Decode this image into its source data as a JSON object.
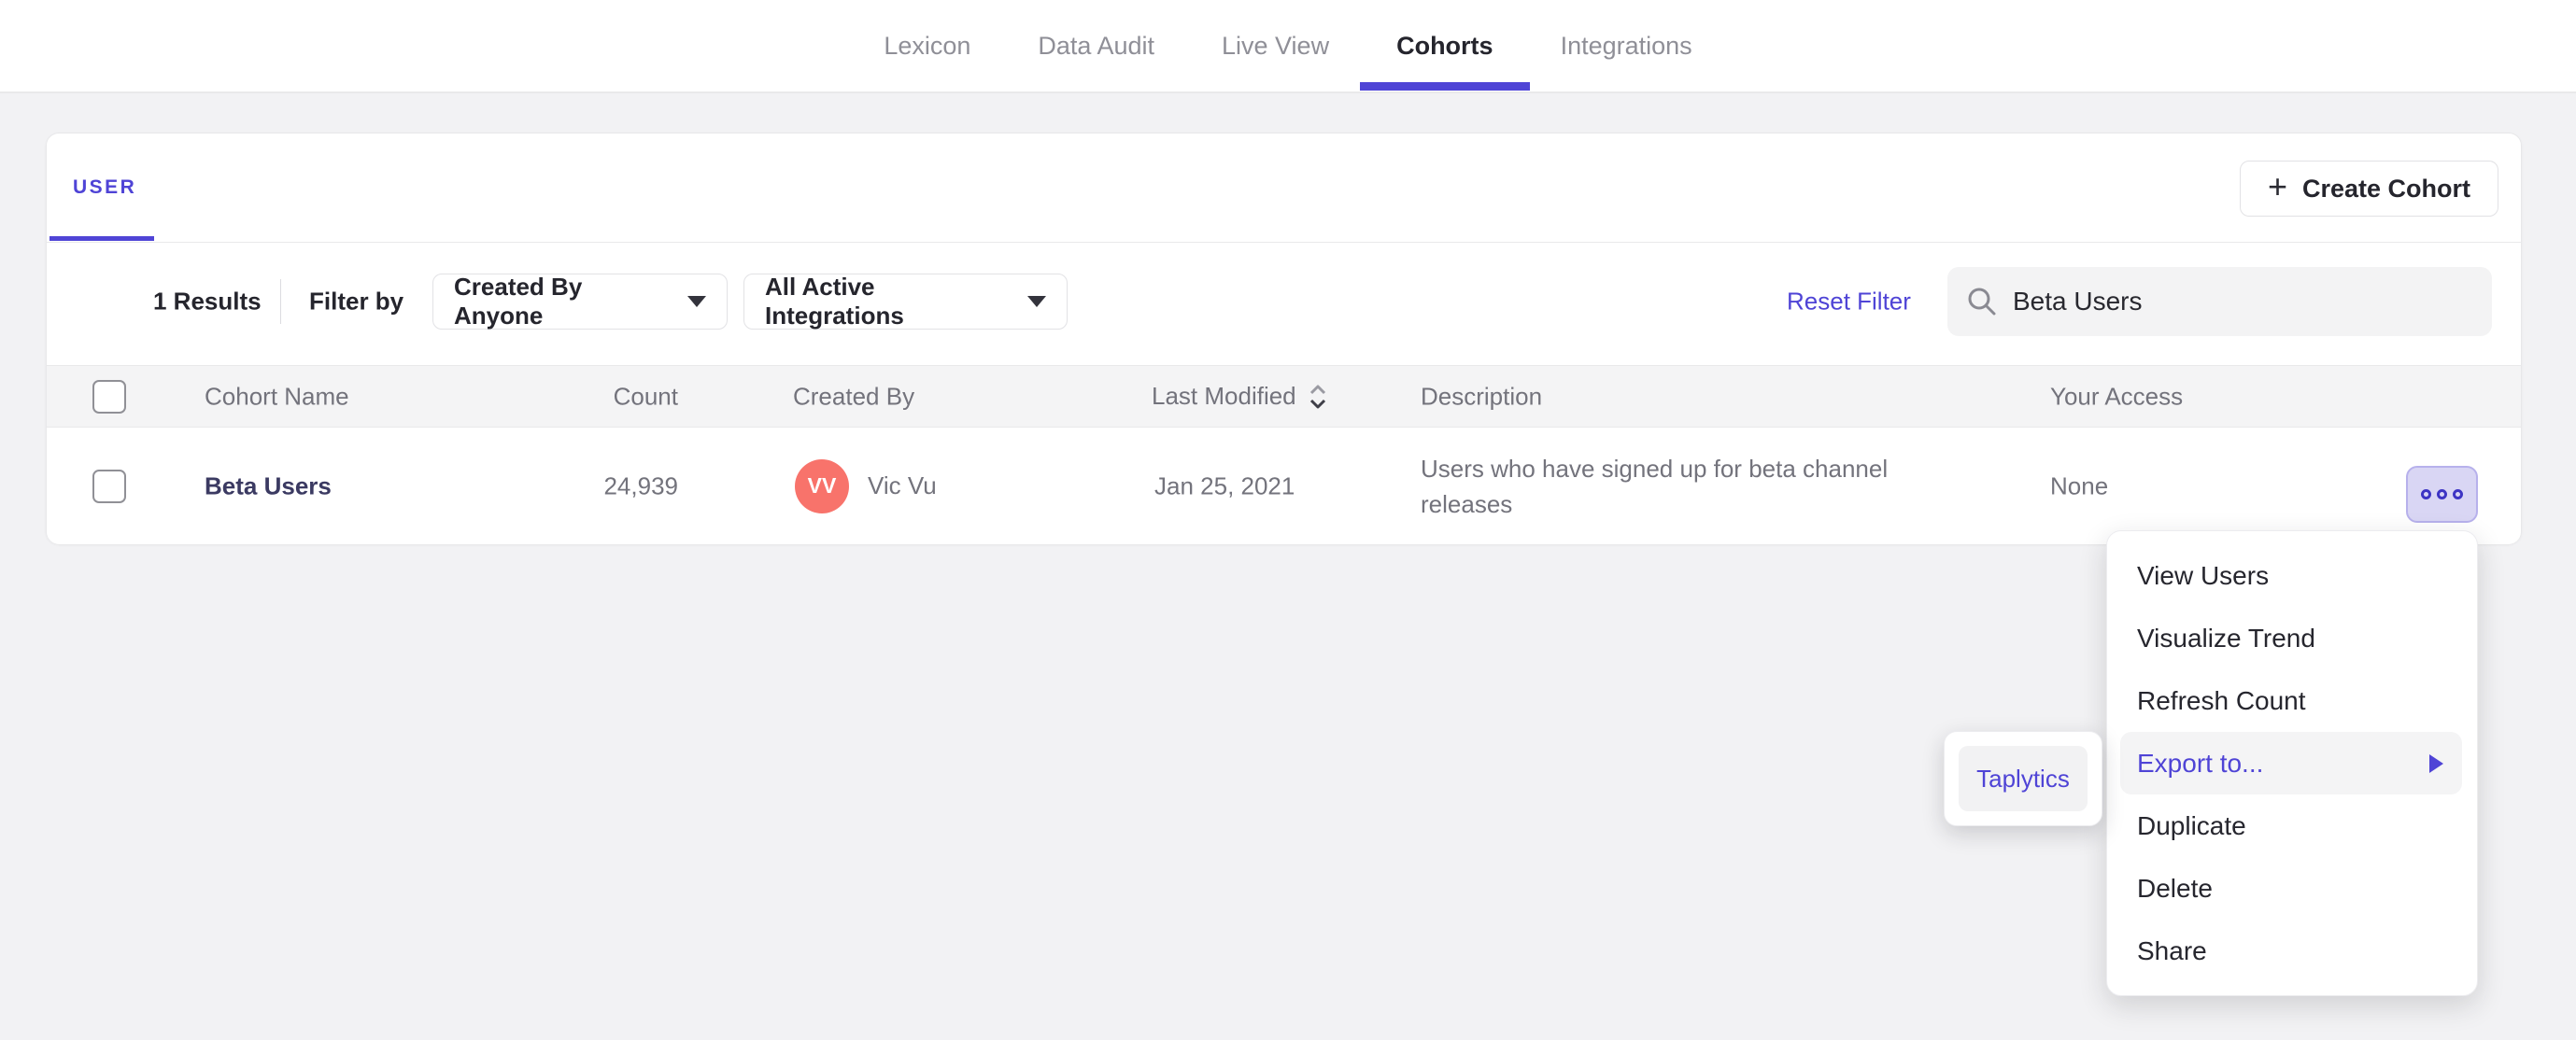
{
  "nav": {
    "items": [
      {
        "label": "Lexicon",
        "active": false
      },
      {
        "label": "Data Audit",
        "active": false
      },
      {
        "label": "Live View",
        "active": false
      },
      {
        "label": "Cohorts",
        "active": true
      },
      {
        "label": "Integrations",
        "active": false
      }
    ]
  },
  "cohorts_card": {
    "tab_label": "USER",
    "create_button_label": "Create Cohort",
    "create_button_icon": "plus-icon",
    "filter_bar": {
      "results_count": "1 Results",
      "filter_by_label": "Filter by",
      "created_by_dropdown": "Created By Anyone",
      "integrations_dropdown": "All Active Integrations",
      "reset_filter_label": "Reset Filter",
      "search_icon": "search-icon",
      "search_value": "Beta Users"
    },
    "table": {
      "headers": {
        "name": "Cohort Name",
        "count": "Count",
        "created_by": "Created By",
        "last_modified": "Last Modified",
        "description": "Description",
        "your_access": "Your Access"
      },
      "rows": [
        {
          "name": "Beta Users",
          "count": "24,939",
          "avatar_initials": "VV",
          "created_by": "Vic Vu",
          "last_modified": "Jan 25, 2021",
          "description": "Users who have signed up for beta channel releases",
          "your_access": "None",
          "actions_icon": "more-options-icon"
        }
      ]
    }
  },
  "context_menu": {
    "items": [
      "View Users",
      "Visualize Trend",
      "Refresh Count",
      "Export to...",
      "Duplicate",
      "Delete",
      "Share"
    ],
    "highlighted_item": "Export to...",
    "submenu": {
      "items": [
        "Taplytics"
      ],
      "highlighted_item": "Taplytics"
    }
  },
  "colors": {
    "accent": "#4F44D6",
    "avatar": "#F8736B",
    "page-bg": "#F2F2F4",
    "header-bg": "#F4F4F5"
  }
}
